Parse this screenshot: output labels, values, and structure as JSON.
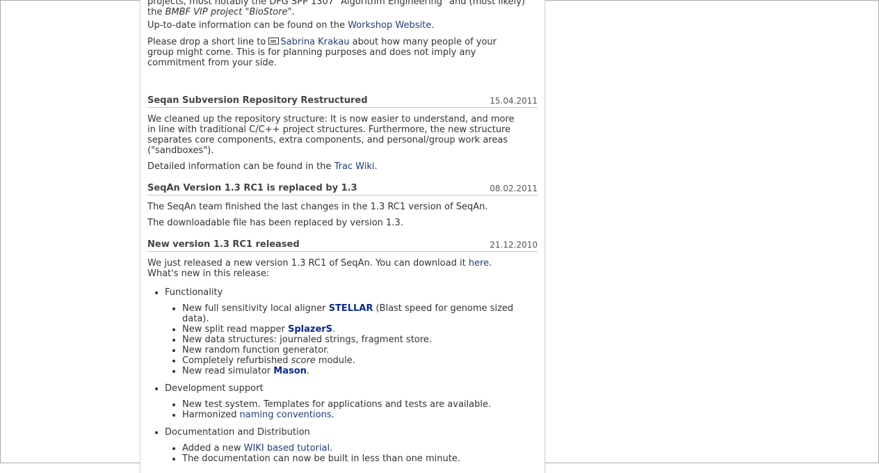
{
  "workshop": {
    "cut_line_top": "projects, most notably the DFG SPP 1307 \"Algorithm Engineering\" and (most likely)",
    "cut_line_2_pre": "the ",
    "cut_line_2_em": "BMBF VIP project \"BioStore\"",
    "cut_line_2_post": ".",
    "info_pre": "Up-to-date information can be found on the ",
    "info_link": "Workshop Website",
    "info_post": ".",
    "drop_pre": "Please drop a short line to ",
    "drop_link": "Sabrina Krakau",
    "drop_line1_post": " about how many people of your",
    "drop_line2": "group might come. This is for planning purposes and does not imply any",
    "drop_line3": "commitment from your side."
  },
  "news": [
    {
      "title": "Seqan Subversion Repository Restructured",
      "date": "15.04.2011",
      "p1_lines": [
        "We cleaned up the repository structure: It is now easier to understand, and more",
        "in line with traditional C/C++ project structures. Furthermore, the new structure",
        "separates core components, extra components, and personal/group work areas",
        "(\"sandboxes\")."
      ],
      "p2_pre": "Detailed information can be found in the ",
      "p2_link": "Trac Wiki",
      "p2_post": "."
    },
    {
      "title": "SeqAn Version 1.3 RC1 is replaced by 1.3",
      "date": "08.02.2011",
      "p1": "The SeqAn team finished the last changes in the 1.3 RC1 version of SeqAn.",
      "p2": "The downloadable file has been replaced by version 1.3."
    },
    {
      "title": "New version 1.3 RC1 released",
      "date": "21.12.2010",
      "intro_pre": "We just released a new version 1.3 RC1 of SeqAn. You can download it ",
      "intro_link": "here",
      "intro_post": ".",
      "intro_line2": "What's new in this release:",
      "sections": {
        "functionality": {
          "label": "Functionality",
          "stellar_pre": "New full sensitivity local aligner ",
          "stellar_link": "STELLAR",
          "stellar_post": " (Blast speed for genome sized",
          "stellar_line2": "data).",
          "splazers_pre": "New split read mapper ",
          "splazers_link": "SplazerS",
          "splazers_post": ".",
          "data_structures": "New data structures: journaled strings, fragment store.",
          "random": "New random function generator.",
          "score_pre": "Completely refurbished ",
          "score_em": "score",
          "score_post": " module.",
          "mason_pre": "New read simulator ",
          "mason_link": "Mason",
          "mason_post": "."
        },
        "development": {
          "label": "Development support",
          "test_system": "New test system. Templates for applications and tests are available.",
          "naming_pre": "Harmonized ",
          "naming_link": "naming conventions",
          "naming_post": "."
        },
        "documentation": {
          "label": "Documentation and Distribution",
          "wiki_pre": "Added a new ",
          "wiki_link": "WIKI based tutorial",
          "wiki_post": ".",
          "built": "The documentation can now be built in less than one minute."
        }
      }
    }
  ]
}
